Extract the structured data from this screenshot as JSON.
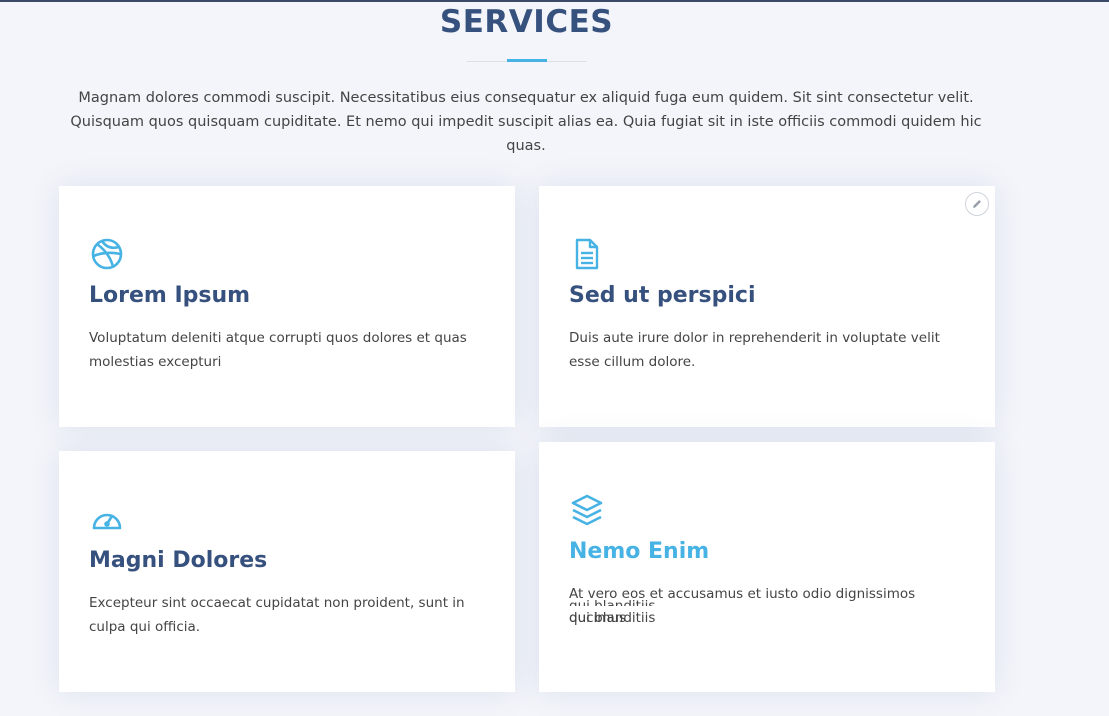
{
  "section": {
    "title": "SERVICES",
    "intro": "Magnam dolores commodi suscipit. Necessitatibus eius consequatur ex aliquid fuga eum quidem. Sit sint consectetur velit. Quisquam quos quisquam cupiditate. Et nemo qui impedit suscipit alias ea. Quia fugiat sit in iste officiis commodi quidem hic quas."
  },
  "colors": {
    "heading": "#37517e",
    "accent": "#47b2e4",
    "text": "#444444",
    "background": "#f3f5fa"
  },
  "services": [
    {
      "icon": "dribbble-icon",
      "title": "Lorem Ipsum",
      "description": "Voluptatum deleniti atque corrupti quos dolores et quas molestias excepturi"
    },
    {
      "icon": "file-document-icon",
      "title": "Sed ut perspici",
      "description": "Duis aute irure dolor in reprehenderit in voluptate velit esse cillum dolore."
    },
    {
      "icon": "speedometer-icon",
      "title": "Magni Dolores",
      "description": "Excepteur sint occaecat cupidatat non proident, sunt in culpa qui officia."
    },
    {
      "icon": "layers-icon",
      "title": "Nemo Enim",
      "description_line1": "At vero eos et accusamus et iusto odio dignissimos ducimus",
      "description_line2": "qui blanditiis"
    }
  ],
  "edit_control": {
    "icon": "pencil-icon"
  }
}
